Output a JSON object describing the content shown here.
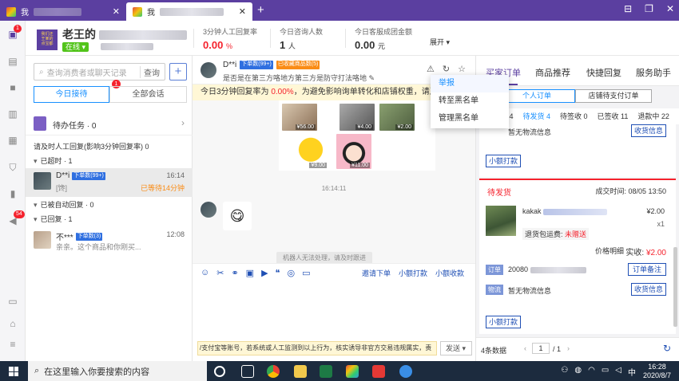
{
  "window": {
    "tabs": [
      {
        "label": "我"
      },
      {
        "label": "我"
      }
    ],
    "new_tab": "+",
    "controls": {
      "minimize": "⊟",
      "restore": "❐",
      "close": "✕"
    }
  },
  "rail": {
    "badges": {
      "chat": "1",
      "notify": "54"
    }
  },
  "header": {
    "shop_name": "老王的",
    "logo_lines": [
      "我们还",
      "王某的",
      "点宝都"
    ],
    "status": "在线",
    "stats": [
      {
        "label": "3分钟人工回复率",
        "value": "0.00",
        "unit": "%"
      },
      {
        "label": "今日咨询人数",
        "value": "1",
        "unit": "人"
      },
      {
        "label": "今日客服成团金额",
        "value": "0.00",
        "unit": "元"
      }
    ],
    "expand": "展开"
  },
  "sessions": {
    "search_placeholder": "查询消费者或聊天记录",
    "search_button": "查询",
    "add": "+",
    "tab_today": "今日接待",
    "tab_today_badge": "1",
    "tab_all": "全部会话",
    "todo": "待办任务 · 0",
    "timely_reply": "请及时人工回复(影响3分钟回复率) 0",
    "groups": {
      "timeout": "已超时 · 1",
      "auto": "已被自动回复 · 0",
      "replied": "已回复 · 1"
    },
    "items": [
      {
        "name": "D**i",
        "tag": "下单数(99+)",
        "time": "16:14",
        "msg": "[馋]",
        "wait": "已等待14分钟"
      },
      {
        "name": "不***",
        "tag": "下单数(3)",
        "time": "12:08",
        "msg": "亲亲。这个商品和你刚买..."
      }
    ]
  },
  "chat": {
    "name": "D**i",
    "tag_orders": "下单数(99+)",
    "tag_fav": "已收藏商品数(5)",
    "subtitle": "是否是在第三方咯地方第三方是防守打法咯地",
    "warning_prefix": "今日3分钟回复率为 ",
    "warning_rate": "0.00%",
    "warning_suffix": "，为避免影响询单转化和店铺权重，请及时",
    "products": [
      {
        "price": "¥56.00"
      },
      {
        "price": "¥4.00"
      },
      {
        "price": "¥2.00"
      },
      {
        "price": "¥9.00"
      },
      {
        "price": "¥11.00"
      }
    ],
    "timestamp": "16:14:11",
    "emoji": "😋",
    "robot_notice": "机器人无法处理，请及时跟进",
    "toolbar_links": [
      "邀请下单",
      "小额打款",
      "小额收款"
    ],
    "input_notice": "/支付宝等账号，若系统或人工监测到以上行为，核实诱导非官方交易违规属实，责",
    "send": "发送"
  },
  "menu": {
    "items": [
      "举报",
      "转至黑名单",
      "管理黑名单"
    ]
  },
  "right": {
    "tabs": [
      "买家订单",
      "商品推荐",
      "快捷回复",
      "服务助手"
    ],
    "sub_personal": "个人订单",
    "sub_store": "店铺待支付订单",
    "status": [
      "未完成 4",
      "待发货 4",
      "待签收 0",
      "已签收 11",
      "退款中 22"
    ],
    "card1": {
      "logistics": "暂无物流信息",
      "receiver_btn": "收货信息",
      "small_pay": "小额打款"
    },
    "order": {
      "status": "待发货",
      "time": "成交时间: 08/05 13:50",
      "product": "kakak",
      "price": "¥2.00",
      "qty": "x1",
      "ship_label": "退货包运费: ",
      "ship_value": "未赠送",
      "price_detail": "价格明细",
      "paid_label": "实收: ",
      "paid_value": "¥2.00",
      "order_label": "订单",
      "order_no": "20080",
      "remark_btn": "订单备注",
      "logistics_label": "物流",
      "logistics": "暂无物流信息",
      "receiver_btn": "收货信息",
      "small_pay": "小额打款"
    },
    "footer": {
      "count": "4条数据",
      "page": "1",
      "total": "/ 1"
    }
  },
  "taskbar": {
    "search_placeholder": "在这里输入你要搜索的内容",
    "time": "16:28",
    "date": "2020/8/7",
    "ime": "中"
  }
}
